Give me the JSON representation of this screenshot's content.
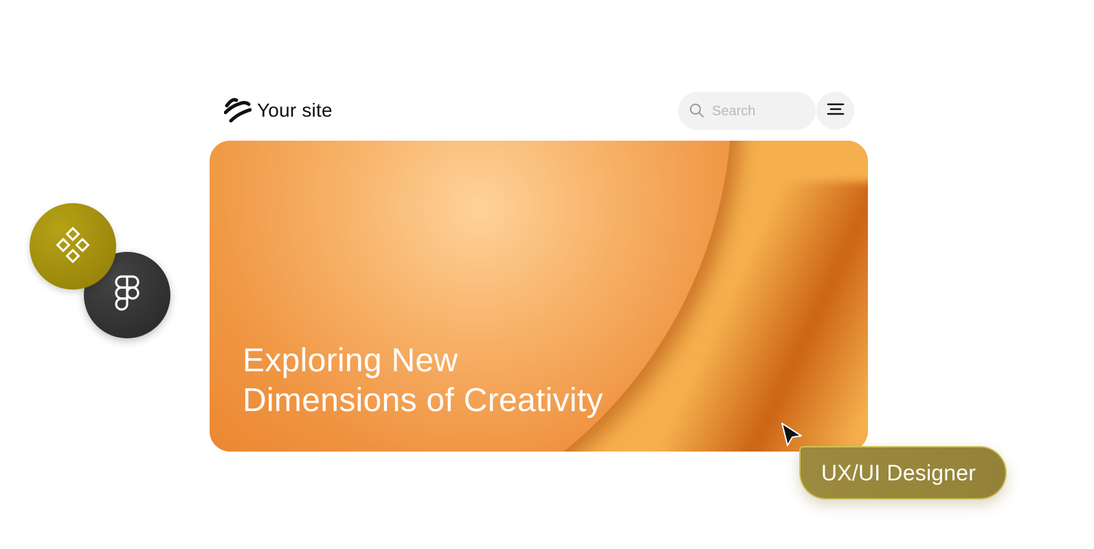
{
  "header": {
    "logo_icon": "wave-logo-icon",
    "site_name": "Your site",
    "search": {
      "placeholder": "Search",
      "value": "",
      "icon": "search-icon"
    },
    "menu_icon": "hamburger-menu-icon"
  },
  "hero": {
    "headline_line1": "Exploring New",
    "headline_line2": "Dimensions of Creativity",
    "colors": {
      "orange_light": "#f5b04d",
      "orange_deep": "#e9701a"
    }
  },
  "floating_badges": [
    {
      "icon": "component-diamonds-icon",
      "color": "#a08c0c"
    },
    {
      "icon": "figma-icon",
      "color": "#2f2f2f"
    }
  ],
  "role_tag": {
    "label": "UX/UI Designer",
    "color": "#9a883c",
    "cursor_icon": "pointer-cursor-icon"
  }
}
